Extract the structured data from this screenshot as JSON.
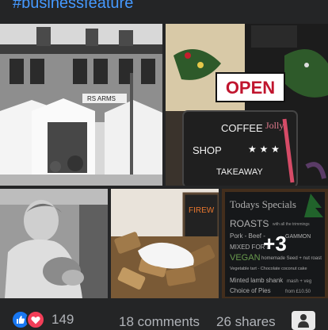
{
  "post": {
    "hashtag": "#businessfeature"
  },
  "photos": {
    "photo1": {
      "sign_text": "RS ARMS"
    },
    "photo2": {
      "open_sign": "OPEN",
      "board_jolly": "Jolly",
      "board_coffee": "COFFEE",
      "board_shop": "SHOP",
      "board_takeaway": "TAKEAWAY"
    },
    "photo4": {
      "board_text": "FIREW"
    },
    "photo5": {
      "title": "Todays Specials",
      "line1": "ROASTS",
      "line1b": "with all the trimmings",
      "line2": "Pork - Beef - ",
      "line2b": "GAMMON",
      "line3": "MIXED FOR £",
      "line4": "VEGAN",
      "line4b": "homemade Seed + nut roast",
      "line5": "Vegetable tart - Chocolate coconut cake",
      "line6": "Minted lamb shank",
      "line6b": "mash + veg",
      "line7": "Choice of Pies",
      "line7b": "from £10.50",
      "more_overlay": "+3"
    }
  },
  "footer": {
    "reaction_count": "149",
    "comments": "18 comments",
    "shares": "26 shares"
  },
  "icons": {
    "like": "like-icon",
    "love": "love-icon",
    "avatar": "profile-avatar-icon"
  },
  "colors": {
    "background": "#242526",
    "hashtag": "#4599ff",
    "like": "#1877f2",
    "love": "#f33e58",
    "meta_text": "#b0b3b8"
  }
}
